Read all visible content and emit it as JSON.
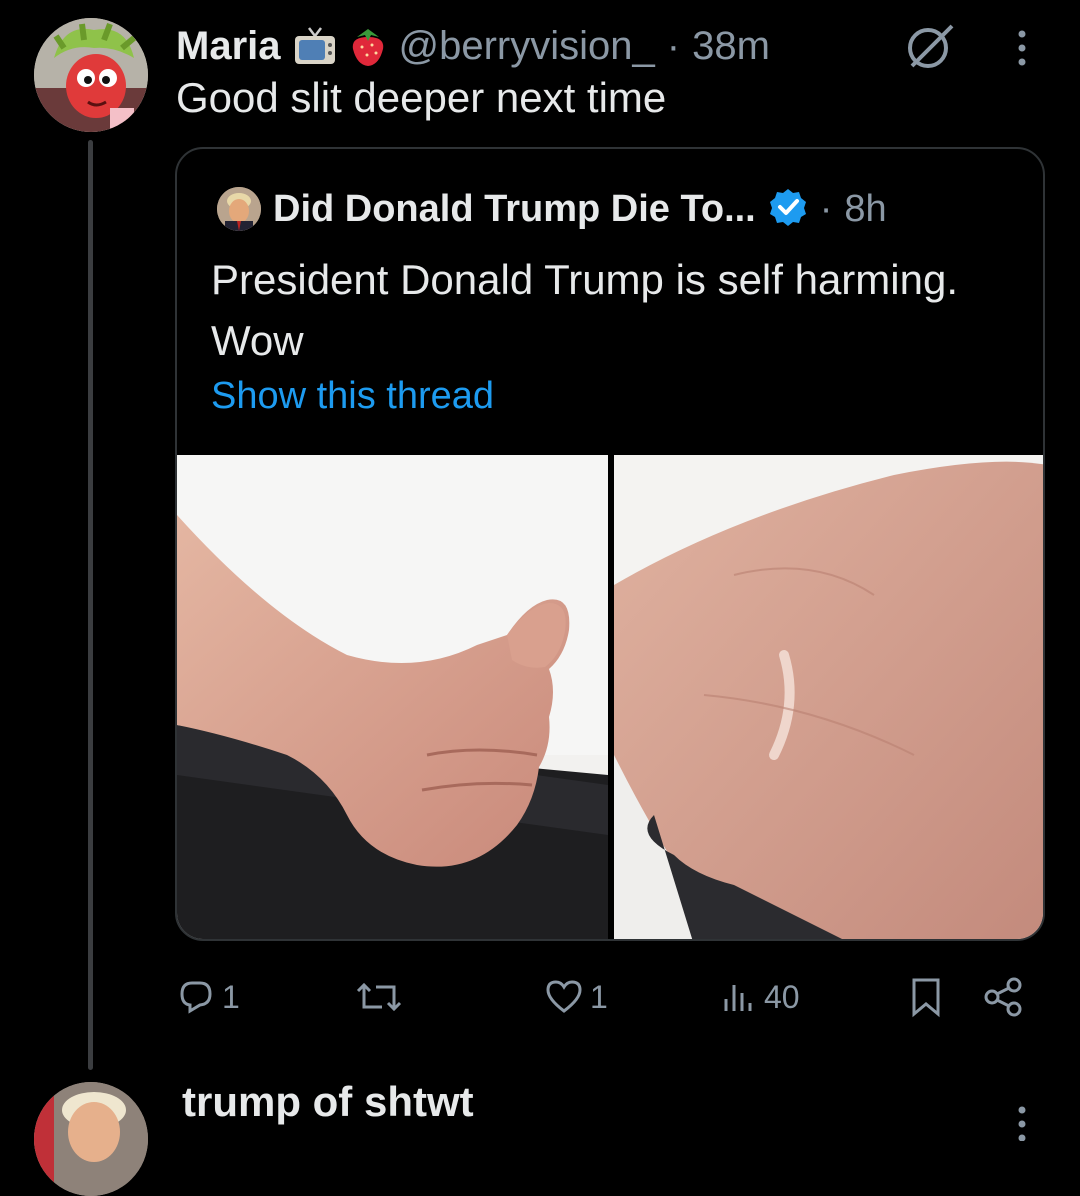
{
  "tweet": {
    "author_name": "Maria",
    "badges": [
      "tv-icon",
      "strawberry-icon"
    ],
    "handle": "@berryvision_",
    "separator": "·",
    "time": "38m",
    "text": "Good slit deeper next time"
  },
  "quoted_tweet": {
    "author_name": "Did Donald Trump Die To...",
    "verified": true,
    "separator": "·",
    "time": "8h",
    "text": "President Donald Trump is self harming. Wow",
    "link_text": "Show this thread",
    "media": [
      "photo-thumbs-up",
      "photo-arm-mark"
    ]
  },
  "actions": {
    "reply_count": "1",
    "retweet_count": "",
    "like_count": "1",
    "views_count": "40"
  },
  "next_tweet": {
    "author_name": "trump of shtwt"
  },
  "colors": {
    "background": "#000000",
    "text": "#e7e9ea",
    "muted": "#8b98a5",
    "link": "#1d9bf0",
    "border": "#2f3336"
  }
}
